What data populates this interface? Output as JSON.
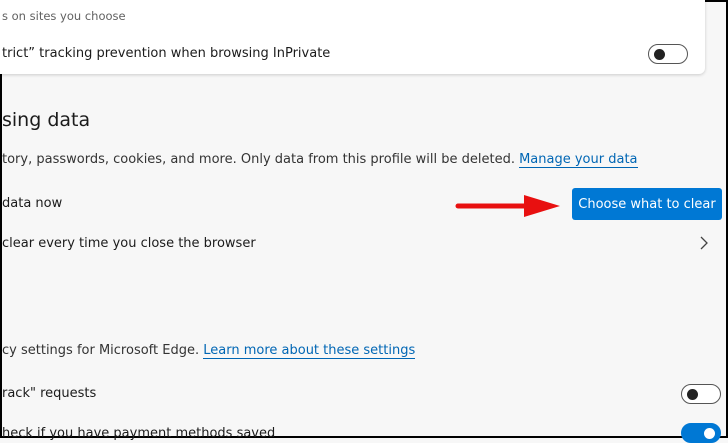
{
  "tracking_card": {
    "subtext": "s on sites you choose",
    "strict_inprivate_label": "trict” tracking prevention when browsing InPrivate",
    "strict_inprivate_on": false
  },
  "clear_browsing": {
    "title": "sing data",
    "description": "tory, passwords, cookies, and more. Only data from this profile will be deleted.",
    "manage_link": "Manage your data",
    "clear_now_label": "data now",
    "choose_button": "Choose what to clear",
    "on_close_label": " clear every time you close the browser"
  },
  "privacy": {
    "description": "cy settings for Microsoft Edge.",
    "learn_link": "Learn more about these settings",
    "dnt_label": "rack\" requests",
    "dnt_on": false,
    "payment_label": "heck if you have payment methods saved",
    "payment_on": true
  },
  "annotation": {
    "arrow_color": "#e81010"
  }
}
